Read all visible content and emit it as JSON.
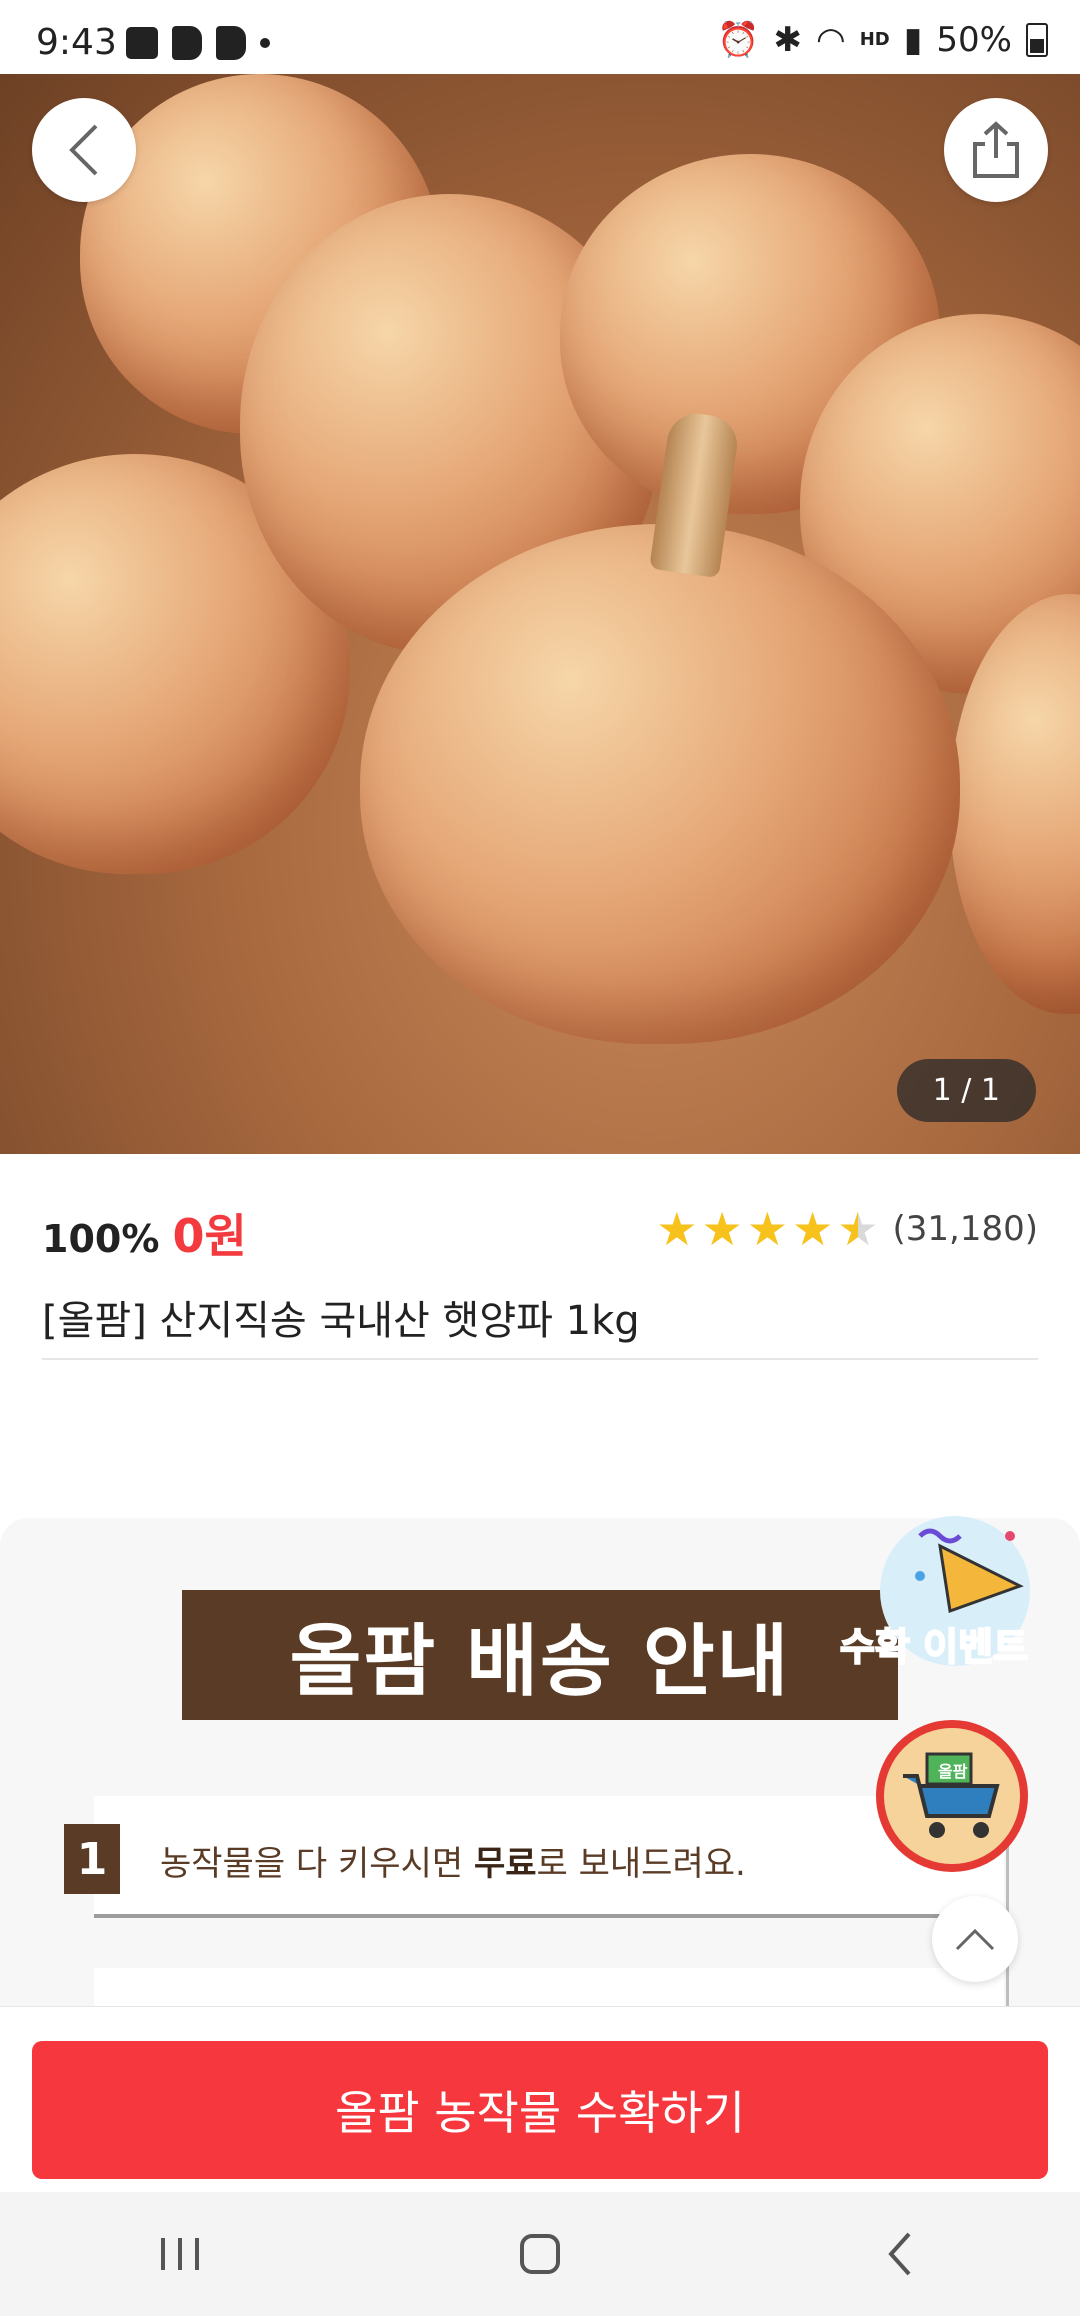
{
  "status_bar": {
    "time": "9:43",
    "battery": "50%",
    "hd_voice": "HD"
  },
  "hero": {
    "counter": "1 / 1"
  },
  "product": {
    "discount": "100%",
    "price": "0원",
    "rating_count": "(31,180)",
    "rating_stars": 4.5,
    "title": "[올팜] 산지직송 국내산 햇양파 1kg"
  },
  "guide": {
    "heading": "올팜 배송 안내",
    "step1_number": "1",
    "step1_pre": "농작물을 다 키우시면 ",
    "step1_bold": "무료",
    "step1_post": "로 보내드려요."
  },
  "floating": {
    "event_label": "수확 이벤트",
    "cart_badge": "올팜"
  },
  "cta": {
    "label": "올팜 농작물 수확하기"
  },
  "colors": {
    "accent": "#f6373e",
    "price": "#f23a3f",
    "brown": "#5a3b26",
    "star": "#f6c21b"
  }
}
